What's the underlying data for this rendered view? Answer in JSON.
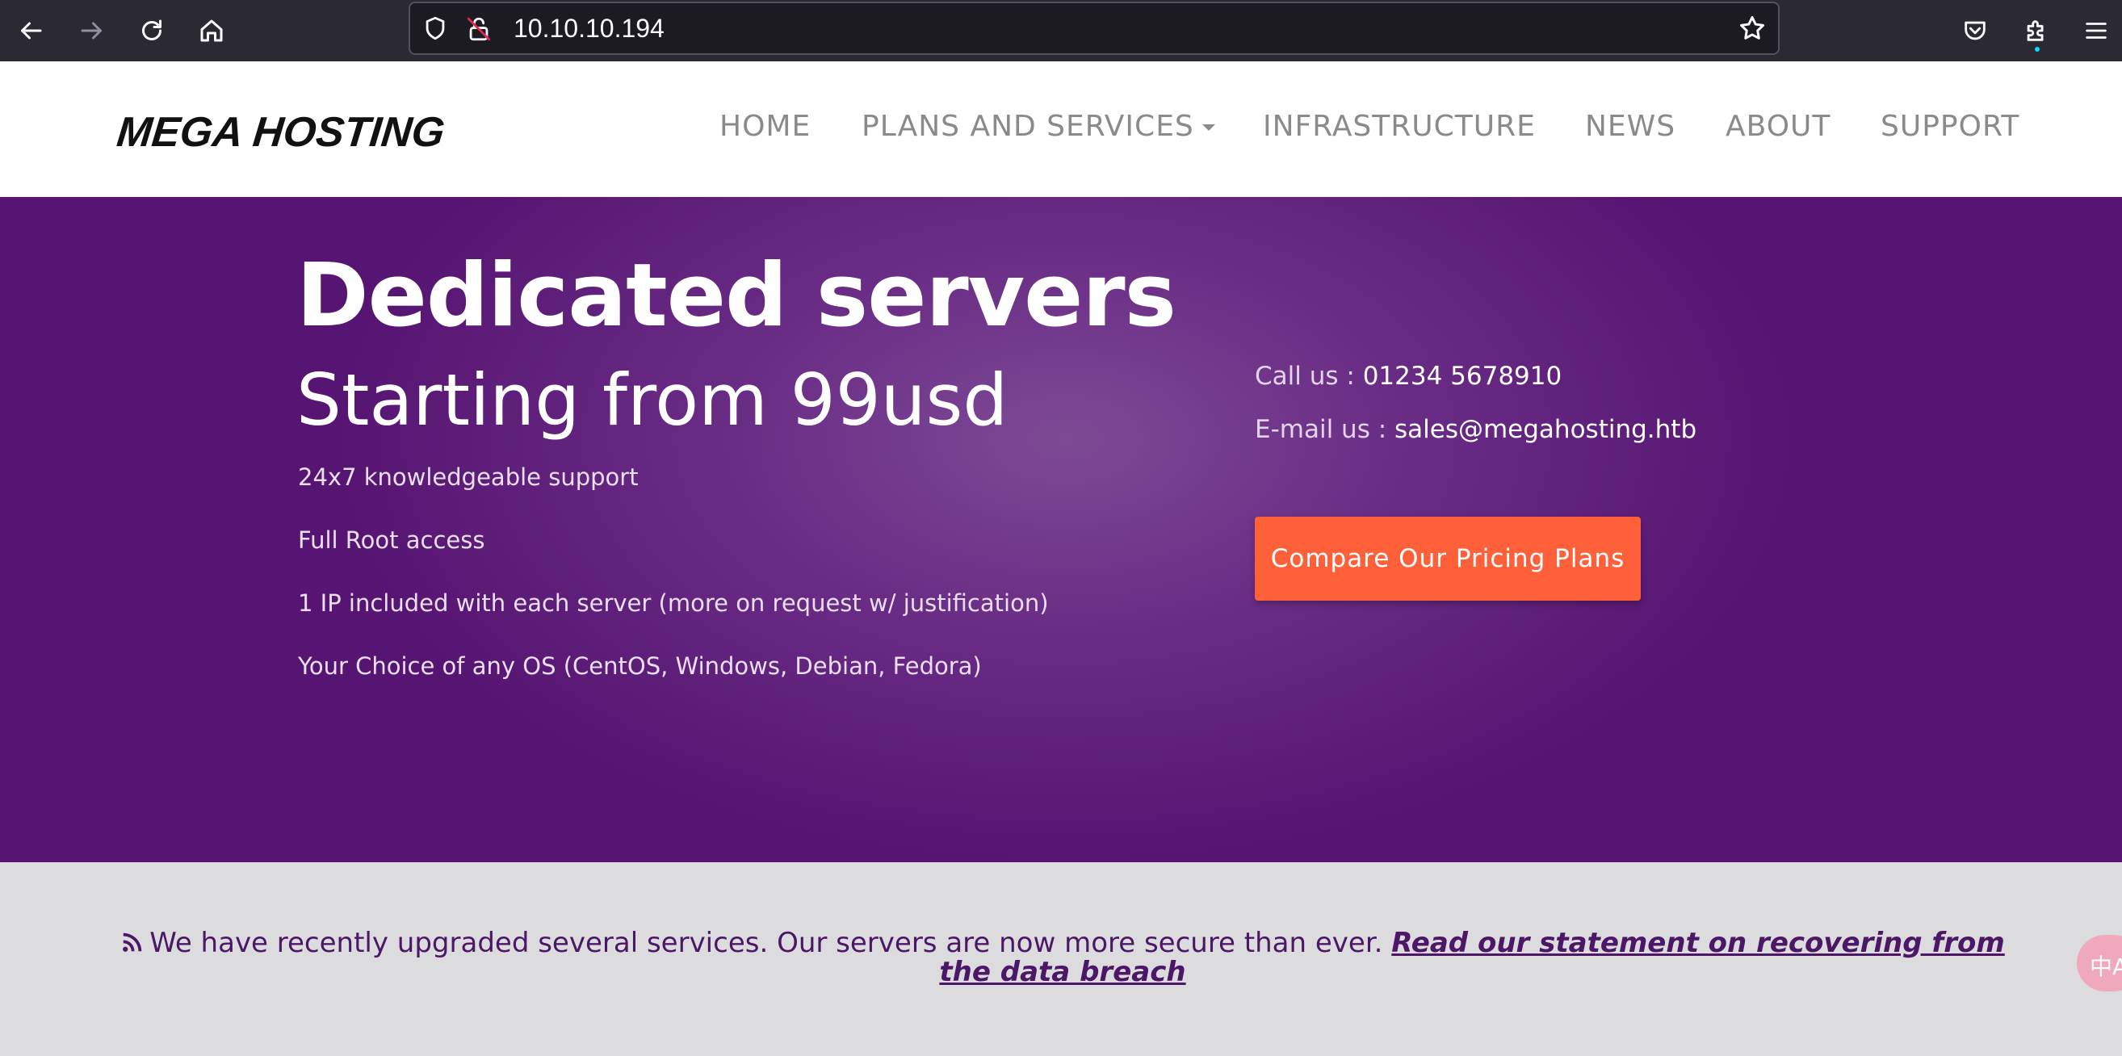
{
  "browser": {
    "url": "10.10.10.194",
    "icons": {
      "back": "back-arrow-icon",
      "forward": "forward-arrow-icon",
      "reload": "reload-icon",
      "home": "home-icon",
      "shield": "tracking-shield-icon",
      "lock": "insecure-lock-icon",
      "bookmark": "star-icon",
      "pocket": "pocket-icon",
      "extensions": "puzzle-icon",
      "menu": "hamburger-menu-icon"
    }
  },
  "site": {
    "logo": "MEGA HOSTING",
    "nav": {
      "home": "HOME",
      "plans": "PLANS AND SERVICES",
      "infrastructure": "INFRASTRUCTURE",
      "news": "NEWS",
      "about": "ABOUT",
      "support": "SUPPORT"
    }
  },
  "hero": {
    "title": "Dedicated servers",
    "subtitle": "Starting from 99usd",
    "features": [
      "24x7 knowledgeable support",
      "Full Root access",
      "1 IP included with each server (more on request w/ justification)",
      "Your Choice of any OS (CentOS, Windows, Debian, Fedora)"
    ],
    "call_label": "Call us : ",
    "call_value": "01234 5678910",
    "email_label": "E-mail us : ",
    "email_value": "sales@megahosting.htb",
    "cta": "Compare Our Pricing Plans"
  },
  "notice": {
    "text": "We have recently upgraded several services. Our servers are now more secure than ever. ",
    "link": "Read our statement on recovering from the data breach",
    "side_button": "中A"
  },
  "colors": {
    "hero_bg": "#6a2d86",
    "cta_bg": "#fe6139",
    "notice_text": "#4b1766",
    "notice_bg": "#dcdbde"
  }
}
